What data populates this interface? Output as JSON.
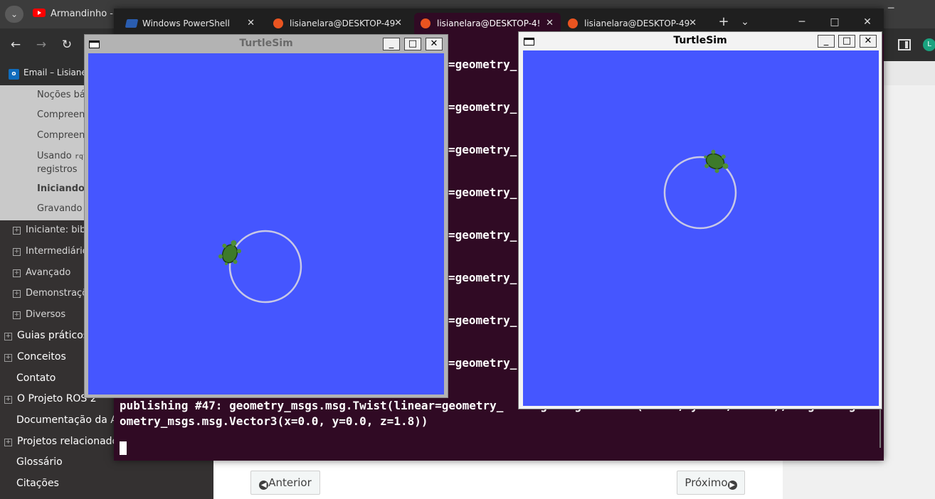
{
  "browser": {
    "tabs": [
      {
        "label": "Armandinho - Oi"
      }
    ],
    "bookmarks": [
      {
        "label": "Email – Lisiane L"
      }
    ],
    "profile_initial": "L",
    "icons": {
      "back": "arrow-left-icon",
      "forward": "arrow-right-icon",
      "reload": "reload-icon"
    }
  },
  "doc_nav": {
    "subitems": [
      {
        "label": "Noções bás"
      },
      {
        "label": "Compreend"
      },
      {
        "label": "Compreend"
      },
      {
        "label_prefix": "Usando",
        "label_code": "rqt_",
        "label_line2": "registros"
      },
      {
        "label": "Iniciando n",
        "current": true
      },
      {
        "label": "Gravando e"
      }
    ],
    "level2": [
      {
        "label": "Iniciante: bibl"
      },
      {
        "label": "Intermediário"
      },
      {
        "label": "Avançado"
      },
      {
        "label": "Demonstraçõ"
      },
      {
        "label": "Diversos"
      }
    ],
    "level1": [
      {
        "label": "Guias práticos",
        "expandable": true
      },
      {
        "label": "Conceitos",
        "expandable": true
      },
      {
        "label": "Contato",
        "expandable": false
      },
      {
        "label": "O Projeto ROS 2",
        "expandable": true
      },
      {
        "label": "Documentação da AP",
        "expandable": false
      },
      {
        "label": "Projetos relacionados",
        "expandable": true
      },
      {
        "label": "Glossário",
        "expandable": false
      },
      {
        "label": "Citações",
        "expandable": false
      }
    ]
  },
  "doc_buttons": {
    "previous": "Anterior",
    "next": "Próximo"
  },
  "terminal": {
    "tabs": [
      {
        "label": "Windows PowerShell",
        "icon": "powershell-icon"
      },
      {
        "label": "lisianelara@DESKTOP-49",
        "icon": "ubuntu-icon"
      },
      {
        "label": "lisianelara@DESKTOP-4!",
        "icon": "ubuntu-icon",
        "active": true
      },
      {
        "label": "lisianelara@DESKTOP-49",
        "icon": "ubuntu-icon"
      }
    ],
    "new_tab": "+",
    "dropdown": "⌄",
    "controls": {
      "minimize": "─",
      "maximize": "□",
      "close": "✕"
    },
    "visible_fragments": [
      "=geometry_",
      "=geometry_",
      "=geometry_",
      "=geometry_",
      "=geometry_",
      "=geometry_",
      "=geometry_",
      "=geometry_"
    ],
    "last_line_1": "publishing #47: geometry_msgs.msg.Twist(linear=geometry_",
    "last_line_1_tail": "msgs.msg.Vector3(x=2.0, y=0.0, z=0.0), angular=ge",
    "last_line_2": "ometry_msgs.msg.Vector3(x=0.0, y=0.0, z=1.8))",
    "colors": {
      "background": "#300a24",
      "text": "#ffffff"
    }
  },
  "turtlesim_left": {
    "title": "TurtleSim",
    "buttons": {
      "minimize": "_",
      "maximize": "□",
      "close": "✕"
    },
    "background": "#4556ff"
  },
  "turtlesim_right": {
    "title": "TurtleSim",
    "buttons": {
      "minimize": "_",
      "maximize": "□",
      "close": "✕"
    },
    "background": "#4556ff"
  }
}
